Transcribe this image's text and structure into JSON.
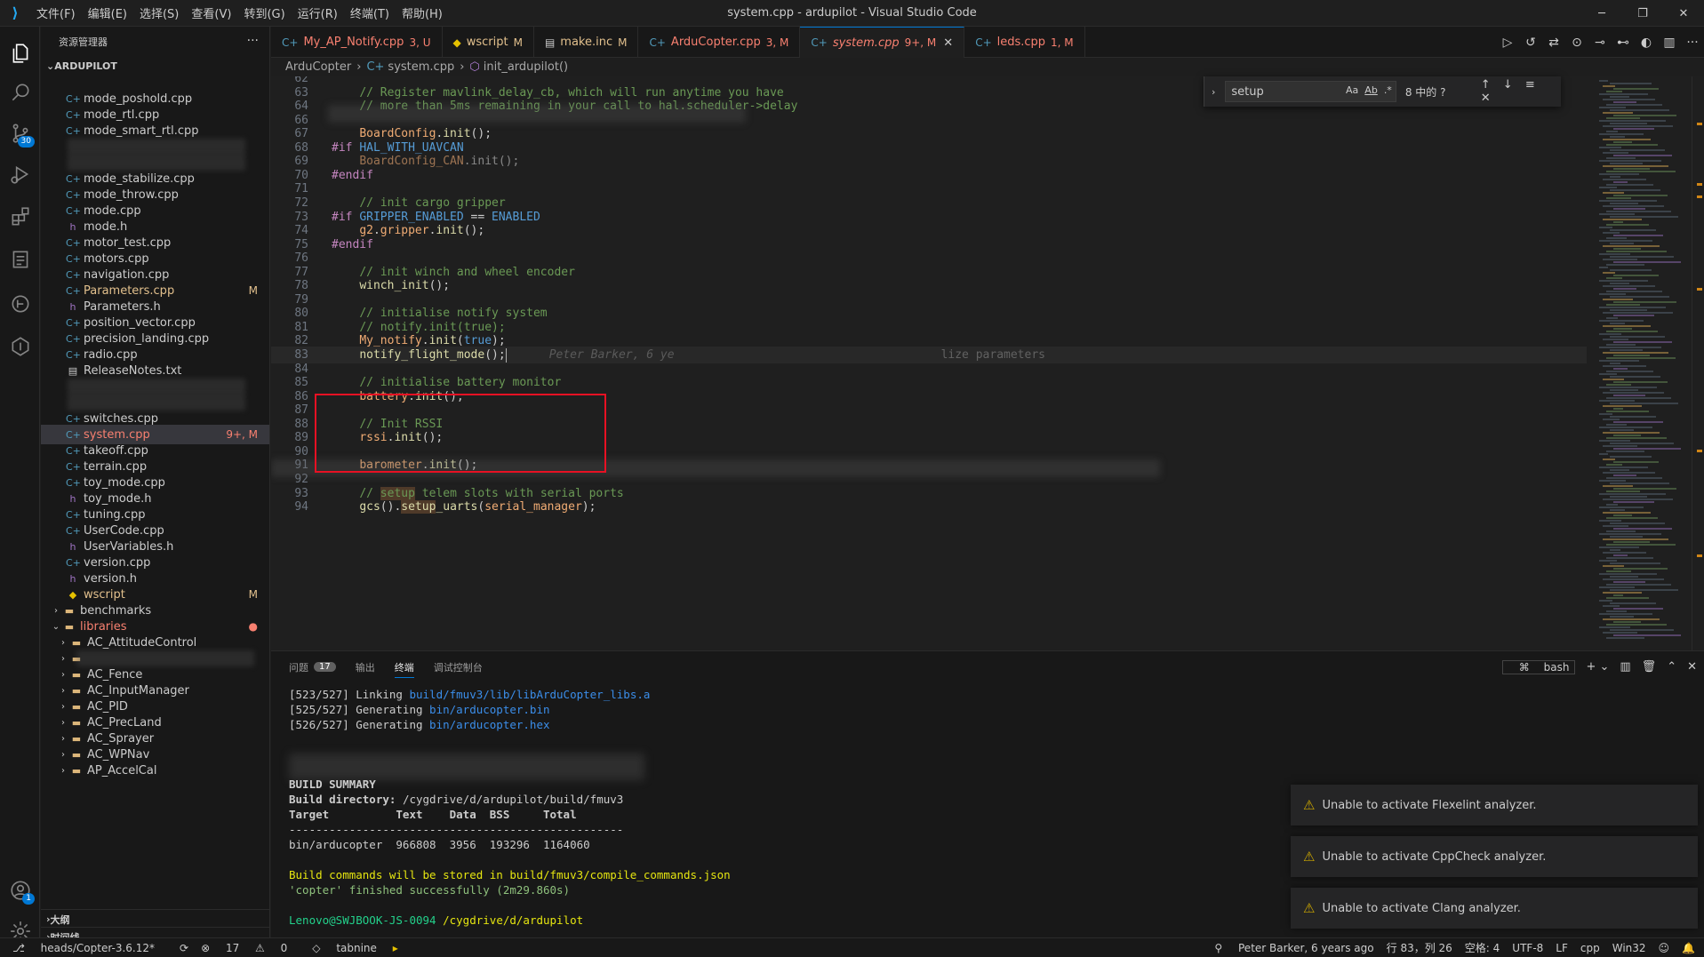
{
  "app": {
    "window_title": "system.cpp - ardupilot - Visual Studio Code",
    "menu": [
      "文件(F)",
      "编辑(E)",
      "选择(S)",
      "查看(V)",
      "转到(G)",
      "运行(R)",
      "终端(T)",
      "帮助(H)"
    ]
  },
  "activity": {
    "scm_badge": "30",
    "account_badge": "1"
  },
  "sidebar": {
    "header": "资源管理器",
    "root": "ARDUPILOT",
    "files": [
      {
        "label": "mode_poshold.cpp",
        "type": "cpp"
      },
      {
        "label": "mode_rtl.cpp",
        "type": "cpp"
      },
      {
        "label": "mode_smart_rtl.cpp",
        "type": "cpp"
      },
      {
        "label": "",
        "type": "blur"
      },
      {
        "label": "",
        "type": "blur"
      },
      {
        "label": "mode_stabilize.cpp",
        "type": "cpp"
      },
      {
        "label": "mode_throw.cpp",
        "type": "cpp"
      },
      {
        "label": "mode.cpp",
        "type": "cpp"
      },
      {
        "label": "mode.h",
        "type": "h"
      },
      {
        "label": "motor_test.cpp",
        "type": "cpp"
      },
      {
        "label": "motors.cpp",
        "type": "cpp"
      },
      {
        "label": "navigation.cpp",
        "type": "cpp"
      },
      {
        "label": "Parameters.cpp",
        "type": "cpp",
        "status": "M",
        "state": "mod"
      },
      {
        "label": "Parameters.h",
        "type": "h"
      },
      {
        "label": "position_vector.cpp",
        "type": "cpp"
      },
      {
        "label": "precision_landing.cpp",
        "type": "cpp"
      },
      {
        "label": "radio.cpp",
        "type": "cpp"
      },
      {
        "label": "ReleaseNotes.txt",
        "type": "txt"
      },
      {
        "label": "",
        "type": "blur"
      },
      {
        "label": "",
        "type": "blur"
      },
      {
        "label": "switches.cpp",
        "type": "cpp"
      },
      {
        "label": "system.cpp",
        "type": "cpp",
        "status": "9+, M",
        "state": "err",
        "selected": true
      },
      {
        "label": "takeoff.cpp",
        "type": "cpp"
      },
      {
        "label": "terrain.cpp",
        "type": "cpp"
      },
      {
        "label": "toy_mode.cpp",
        "type": "cpp"
      },
      {
        "label": "toy_mode.h",
        "type": "h"
      },
      {
        "label": "tuning.cpp",
        "type": "cpp"
      },
      {
        "label": "UserCode.cpp",
        "type": "cpp"
      },
      {
        "label": "UserVariables.h",
        "type": "h"
      },
      {
        "label": "version.cpp",
        "type": "cpp"
      },
      {
        "label": "version.h",
        "type": "h"
      },
      {
        "label": "wscript",
        "type": "py",
        "status": "M",
        "state": "mod"
      }
    ],
    "folders": [
      {
        "label": "benchmarks",
        "depth": 1,
        "open": false
      },
      {
        "label": "libraries",
        "depth": 0,
        "open": true,
        "state": "err",
        "status": "●"
      },
      {
        "label": "AC_AttitudeControl",
        "depth": 2,
        "open": false
      },
      {
        "label": "",
        "depth": 2,
        "open": false,
        "blur": true
      },
      {
        "label": "AC_Fence",
        "depth": 2,
        "open": false
      },
      {
        "label": "AC_InputManager",
        "depth": 2,
        "open": false
      },
      {
        "label": "AC_PID",
        "depth": 2,
        "open": false
      },
      {
        "label": "AC_PrecLand",
        "depth": 2,
        "open": false
      },
      {
        "label": "AC_Sprayer",
        "depth": 2,
        "open": false
      },
      {
        "label": "AC_WPNav",
        "depth": 2,
        "open": false
      },
      {
        "label": "AP_AccelCal",
        "depth": 2,
        "open": false
      }
    ],
    "outline": "大纲",
    "timeline": "时间线"
  },
  "tabs": [
    {
      "name": "My_AP_Notify.cpp",
      "badge": "3, U",
      "icon": "cpp",
      "state": "err"
    },
    {
      "name": "wscript",
      "badge": "M",
      "icon": "py",
      "state": "mod"
    },
    {
      "name": "make.inc",
      "badge": "M",
      "icon": "inc",
      "state": "mod"
    },
    {
      "name": "ArduCopter.cpp",
      "badge": "3, M",
      "icon": "cpp",
      "state": "err"
    },
    {
      "name": "system.cpp",
      "badge": "9+, M",
      "icon": "cpp",
      "state": "err",
      "active": true
    },
    {
      "name": "leds.cpp",
      "badge": "1, M",
      "icon": "cpp",
      "state": "err"
    }
  ],
  "breadcrumb": {
    "folder": "ArduCopter",
    "file": "system.cpp",
    "symbol": "init_ardupilot()"
  },
  "find": {
    "query": "setup",
    "count": "8 中的 ?",
    "case_label": "Aa",
    "word_label": "Ab",
    "regex_label": ".*"
  },
  "editor": {
    "lines": [
      {
        "n": "62",
        "html": ""
      },
      {
        "n": "63",
        "html": "    <span class='c-comment'>// Register mavlink_delay_cb, which will run anytime you have</span>"
      },
      {
        "n": "64",
        "html": "    <span class='c-comment'>// more than 5ms remaining in your call to hal.scheduler-&gt;delay</span>"
      },
      {
        "n": "66",
        "html": ""
      },
      {
        "n": "67",
        "html": "    <span class='c-cls'>BoardConfig</span>.<span class='c-fn'>init</span>();"
      },
      {
        "n": "68",
        "html": "<span class='c-macro'>#if</span> <span class='c-macro2'>HAL_WITH_UAVCAN</span>"
      },
      {
        "n": "69",
        "html": "    <span class='c-cls' style='opacity:0.6'>BoardConfig_CAN</span><span style='opacity:0.6'>.init();</span>"
      },
      {
        "n": "70",
        "html": "<span class='c-macro'>#endif</span>"
      },
      {
        "n": "71",
        "html": ""
      },
      {
        "n": "72",
        "html": "    <span class='c-comment'>// init cargo gripper</span>"
      },
      {
        "n": "73",
        "html": "<span class='c-macro'>#if</span> <span class='c-macro2'>GRIPPER_ENABLED</span> == <span class='c-macro2'>ENABLED</span>"
      },
      {
        "n": "74",
        "html": "    <span class='c-cls'>g2</span>.<span class='c-cls'>gripper</span>.<span class='c-fn'>init</span>();"
      },
      {
        "n": "75",
        "html": "<span class='c-macro'>#endif</span>"
      },
      {
        "n": "76",
        "html": ""
      },
      {
        "n": "77",
        "html": "    <span class='c-comment'>// init winch and wheel encoder</span>"
      },
      {
        "n": "78",
        "html": "    <span class='c-fn'>winch_init</span>();"
      },
      {
        "n": "79",
        "html": ""
      },
      {
        "n": "80",
        "html": "    <span class='c-comment'>// initialise notify system</span>"
      },
      {
        "n": "81",
        "html": "    <span class='c-comment'>// notify.init(true);</span>"
      },
      {
        "n": "82",
        "html": "    <span class='c-cls'>My_notify</span>.<span class='c-fn'>init</span>(<span class='c-kw'>true</span>);"
      },
      {
        "n": "83",
        "html": "    <span class='c-fn'>notify_flight_mode</span>();<span class='cursor'></span><span class='c-blame'>Peter Barker, 6 ye</span><span class='c-ghost' style='margin-left:300px'>lize parameters</span>",
        "current": true
      },
      {
        "n": "84",
        "html": ""
      },
      {
        "n": "85",
        "html": "    <span class='c-comment'>// initialise battery monitor</span>"
      },
      {
        "n": "86",
        "html": "    <span class='c-cls'>battery</span>.<span class='c-fn'>init</span>();"
      },
      {
        "n": "87",
        "html": ""
      },
      {
        "n": "88",
        "html": "    <span class='c-comment'>// Init RSSI</span>"
      },
      {
        "n": "89",
        "html": "    <span class='c-cls'>rssi</span>.<span class='c-fn'>init</span>();"
      },
      {
        "n": "90",
        "html": ""
      },
      {
        "n": "91",
        "html": "    <span class='c-cls'>barometer</span>.<span class='c-fn'>init</span>();"
      },
      {
        "n": "92",
        "html": ""
      },
      {
        "n": "93",
        "html": "    <span class='c-comment'>// <span class='c-find'>setup</span> telem slots with serial ports</span>"
      },
      {
        "n": "94",
        "html": "    <span class='c-fn'>gcs</span>().<span class='c-fn'><span class='c-find'>setup</span>_uarts</span>(<span class='c-cls'>serial_manager</span>);"
      }
    ]
  },
  "panel": {
    "tabs": [
      {
        "label": "问题",
        "count": "17"
      },
      {
        "label": "输出"
      },
      {
        "label": "终端",
        "active": true
      },
      {
        "label": "调试控制台"
      }
    ],
    "shell": "bash",
    "terminal": [
      {
        "html": "[523/527] Linking <span class='bl'>build/fmuv3/lib/libArduCopter_libs.a</span>"
      },
      {
        "html": "[525/527] Generating <span class='bl'>bin/arducopter.bin</span>"
      },
      {
        "html": "[526/527] Generating <span class='bl'>bin/arducopter.hex</span>"
      },
      {
        "html": ""
      },
      {
        "html": ""
      },
      {
        "html": ""
      },
      {
        "html": "<span class='bd'>BUILD SUMMARY</span>"
      },
      {
        "html": "<span class='bd'>Build directory:</span> /cygdrive/d/ardupilot/build/fmuv3"
      },
      {
        "html": "<span class='bd'>Target          Text    Data  BSS     Total</span>"
      },
      {
        "html": "--------------------------------------------------"
      },
      {
        "html": "bin/arducopter  966808  3956  193296  1164060"
      },
      {
        "html": ""
      },
      {
        "html": "<span class='yl'>Build commands will be stored in build/fmuv3/compile_commands.json</span>"
      },
      {
        "html": "<span class='gn2'>'copter' finished successfully (2m29.860s)</span>"
      },
      {
        "html": ""
      },
      {
        "html": "<span class='gr'>Lenovo@SWJBOOK-JS-0094</span> <span class='yl'>/cygdrive/d/ardupilot</span>"
      }
    ]
  },
  "notifications": [
    "Unable to activate Flexelint analyzer.",
    "Unable to activate CppCheck analyzer.",
    "Unable to activate Clang analyzer."
  ],
  "status": {
    "branch": "heads/Copter-3.6.12*",
    "errors": "17",
    "warnings": "0",
    "tabnine": "tabnine",
    "blame": "Peter Barker, 6 years ago",
    "position": "行 83，列 26",
    "spaces": "空格: 4",
    "encoding": "UTF-8",
    "eol": "LF",
    "language": "cpp",
    "platform": "Win32"
  },
  "colors": {
    "accent": "#0078d4",
    "error_text": "#f88070",
    "modified_text": "#e2c08d",
    "highlight_box": "#e81123"
  }
}
